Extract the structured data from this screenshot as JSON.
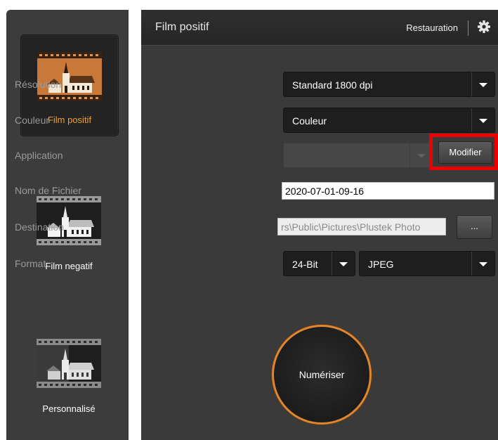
{
  "sidebar": {
    "modes": [
      {
        "label": "Film positif",
        "selected": true
      },
      {
        "label": "Film negatif",
        "selected": false
      },
      {
        "label": "Personnalisé",
        "selected": false
      }
    ]
  },
  "header": {
    "title": "Film positif",
    "restore_label": "Restauration",
    "settings_icon": "gear-icon"
  },
  "form": {
    "resolution": {
      "label": "Résolution",
      "value": "Standard 1800 dpi"
    },
    "color": {
      "label": "Couleur",
      "value": "Couleur"
    },
    "application": {
      "label": "Application",
      "value": "",
      "button_label": "Modifier"
    },
    "filename": {
      "label": "Nom de Fichier",
      "value": "2020-07-01-09-16"
    },
    "destination": {
      "label": "Destination",
      "value": "rs\\Public\\Pictures\\Plustek Photo",
      "browse_label": "..."
    },
    "format": {
      "label": "Format",
      "bit_depth": "24-Bit",
      "file_type": "JPEG"
    }
  },
  "scan_button_label": "Numériser",
  "colors": {
    "accent": "#e08530",
    "highlight": "#ee0000",
    "panel": "#3a3a3a",
    "sidebar": "#3c3c3c"
  }
}
